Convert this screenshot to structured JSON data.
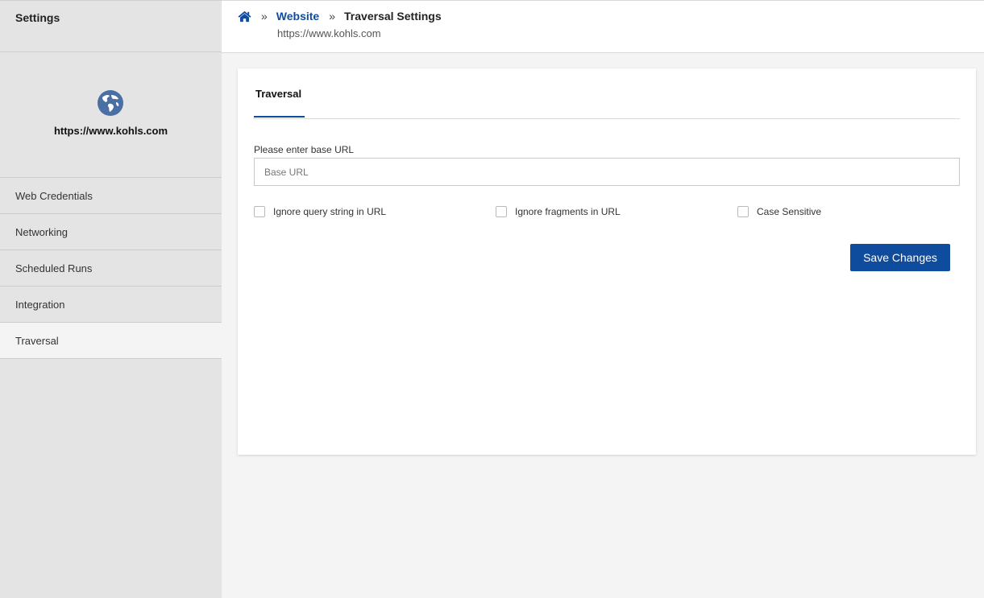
{
  "sidebar": {
    "title": "Settings",
    "site_url": "https://www.kohls.com",
    "items": [
      {
        "label": "Web Credentials"
      },
      {
        "label": "Networking"
      },
      {
        "label": "Scheduled Runs"
      },
      {
        "label": "Integration"
      },
      {
        "label": "Traversal",
        "active": true
      }
    ]
  },
  "header": {
    "breadcrumb": {
      "home_icon": "home-icon",
      "separator": "»",
      "link": "Website",
      "current": "Traversal Settings"
    },
    "subtitle": "https://www.kohls.com"
  },
  "main": {
    "tabs": [
      {
        "label": "Traversal",
        "active": true
      }
    ],
    "base_url": {
      "label": "Please enter base URL",
      "value": "",
      "placeholder": "Base URL"
    },
    "options": [
      {
        "label": "Ignore query string in URL",
        "checked": false
      },
      {
        "label": "Ignore fragments in URL",
        "checked": false
      },
      {
        "label": "Case Sensitive",
        "checked": false
      }
    ],
    "save_label": "Save Changes"
  },
  "colors": {
    "accent": "#0f4c9e",
    "sidebar_bg": "#e4e4e4",
    "page_bg": "#f4f4f4",
    "globe": "#4a6fa5"
  }
}
